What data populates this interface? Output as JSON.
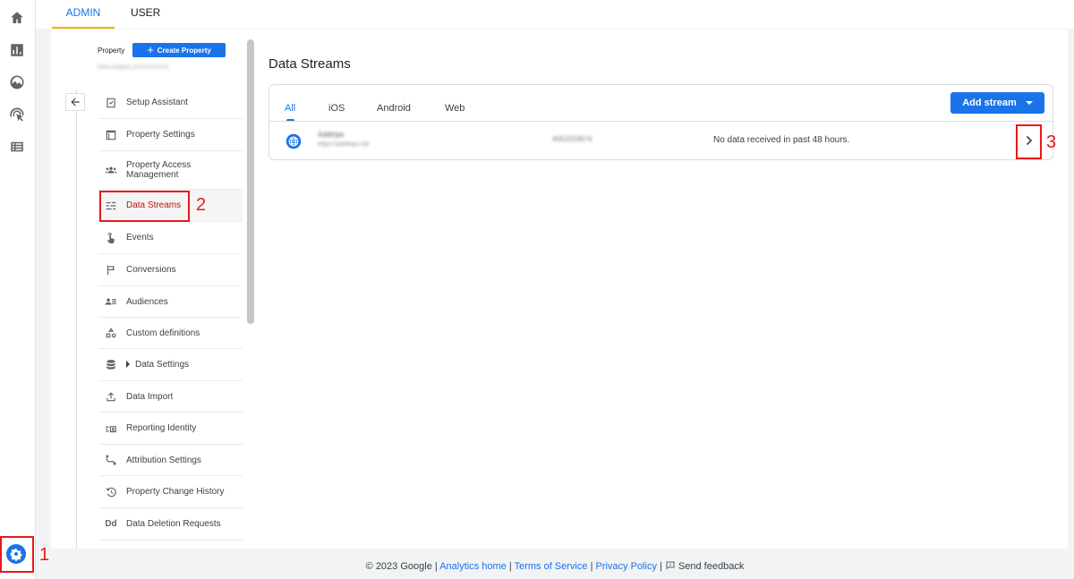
{
  "top_tabs": {
    "admin": "ADMIN",
    "user": "USER"
  },
  "property": {
    "label": "Property",
    "create_button": "Create Property",
    "create_button_icon": "plus-icon",
    "name_blurred": "GA4 Added (XXXXXXXX)"
  },
  "nav_items": [
    {
      "label": "Setup Assistant",
      "icon": "checklist-icon"
    },
    {
      "label": "Property Settings",
      "icon": "window-icon"
    },
    {
      "label": "Property Access Management",
      "icon": "people-icon"
    },
    {
      "label": "Data Streams",
      "icon": "streams-icon"
    },
    {
      "label": "Events",
      "icon": "touch-icon"
    },
    {
      "label": "Conversions",
      "icon": "flag-icon"
    },
    {
      "label": "Audiences",
      "icon": "audience-icon"
    },
    {
      "label": "Custom definitions",
      "icon": "shapes-icon"
    },
    {
      "label": "Data Settings",
      "icon": "database-icon"
    },
    {
      "label": "Data Import",
      "icon": "upload-icon"
    },
    {
      "label": "Reporting Identity",
      "icon": "identity-icon"
    },
    {
      "label": "Attribution Settings",
      "icon": "attribution-icon"
    },
    {
      "label": "Property Change History",
      "icon": "history-icon"
    },
    {
      "label": "Data Deletion Requests",
      "icon": "dd-icon"
    }
  ],
  "data_streams": {
    "title": "Data Streams",
    "tabs": [
      "All",
      "iOS",
      "Android",
      "Web"
    ],
    "active_tab": "All",
    "add_button": "Add stream",
    "stream": {
      "name_blurred": "Addtrips",
      "url_blurred": "https://addtrips.net",
      "id_blurred": "4052333674",
      "status": "No data received in past 48 hours."
    }
  },
  "annotations": {
    "n1": "1",
    "n2": "2",
    "n3": "3"
  },
  "footer": {
    "copyright": "© 2023 Google",
    "sep": "|",
    "analytics_home": "Analytics home",
    "terms": "Terms of Service",
    "privacy": "Privacy Policy",
    "feedback": "Send feedback"
  },
  "dd_glyph": "Dd",
  "colors": {
    "accent": "#1a73e8",
    "annotation": "#e8191c",
    "tab_underline": "#f9ab00"
  }
}
